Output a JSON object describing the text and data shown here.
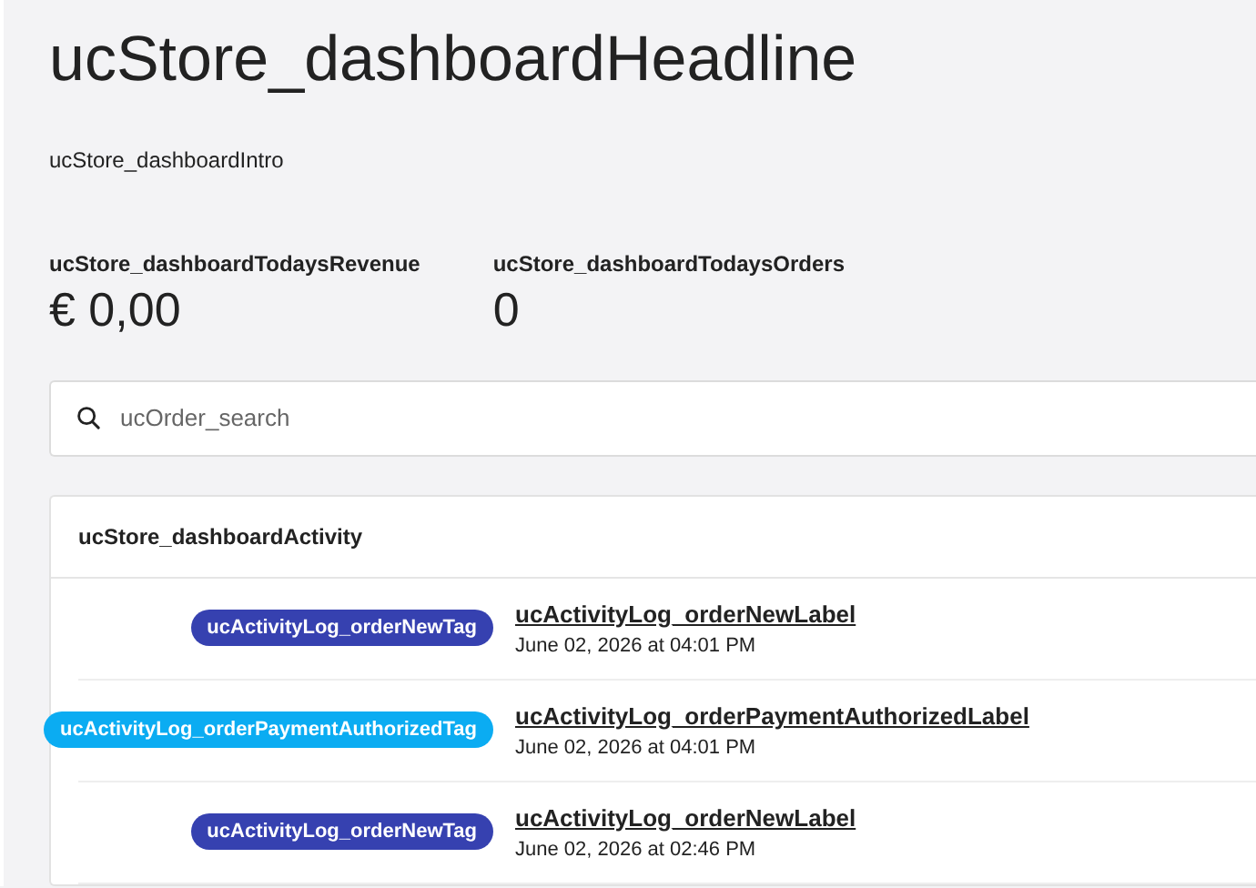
{
  "headline": "ucStore_dashboardHeadline",
  "intro": "ucStore_dashboardIntro",
  "stats": [
    {
      "label": "ucStore_dashboardTodaysRevenue",
      "value": "€ 0,00"
    },
    {
      "label": "ucStore_dashboardTodaysOrders",
      "value": "0"
    }
  ],
  "search": {
    "placeholder": "ucOrder_search"
  },
  "activity": {
    "title": "ucStore_dashboardActivity",
    "items": [
      {
        "tag": "ucActivityLog_orderNewTag",
        "color": "#3641b0",
        "label": "ucActivityLog_orderNewLabel",
        "time": "June 02, 2026 at 04:01 PM"
      },
      {
        "tag": "ucActivityLog_orderPaymentAuthorizedTag",
        "color": "#0bacf2",
        "label": "ucActivityLog_orderPaymentAuthorizedLabel",
        "time": "June 02, 2026 at 04:01 PM"
      },
      {
        "tag": "ucActivityLog_orderNewTag",
        "color": "#3641b0",
        "label": "ucActivityLog_orderNewLabel",
        "time": "June 02, 2026 at 02:46 PM"
      }
    ]
  }
}
